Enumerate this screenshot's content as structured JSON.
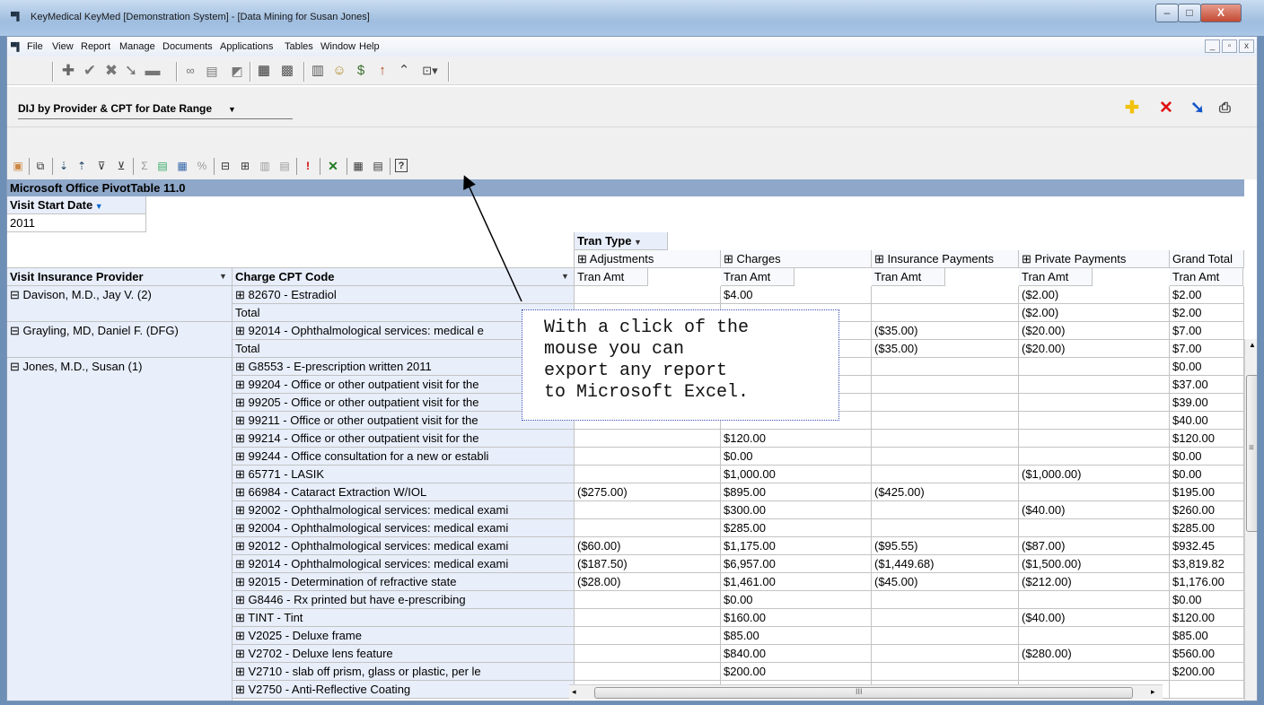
{
  "window": {
    "title": "KeyMedical KeyMed [Demonstration System] - [Data Mining for Susan Jones]",
    "app_icon": "app-icon",
    "caption_buttons": [
      "–",
      "□",
      "X"
    ]
  },
  "menu": {
    "items": [
      "File",
      "View",
      "Report",
      "Manage",
      "Documents",
      "Applications",
      "Tables",
      "Window",
      "Help"
    ],
    "mdi_buttons": [
      "_",
      "̅",
      "x"
    ]
  },
  "report": {
    "selected": "DIJ by Provider & CPT for Date Range",
    "dropdown_arrow": "▼"
  },
  "pivot": {
    "title": "Microsoft Office PivotTable 11.0",
    "filter_field": "Visit Start Date",
    "filter_value": "2011",
    "column_field": "Tran Type",
    "columns": [
      "⊞ Adjustments",
      "⊞ Charges",
      "⊞ Insurance Payments",
      "⊞ Private Payments",
      "Grand Total"
    ],
    "data_field": "Tran Amt",
    "row_field1": "Visit Insurance Provider",
    "row_field2": "Charge CPT Code",
    "providers": [
      "⊟ Davison, M.D., Jay V. (2)",
      "⊟ Grayling, MD, Daniel F. (DFG)",
      "⊟ Jones, M.D., Susan  (1)"
    ],
    "rows": [
      {
        "code": "⊞ 82670 - Estradiol",
        "adj": "",
        "chg": "$4.00",
        "ins": "",
        "prv": "($2.00)",
        "tot": "$2.00"
      },
      {
        "code": "Total",
        "adj": "",
        "chg": "",
        "ins": "",
        "prv": "($2.00)",
        "tot": "$2.00"
      },
      {
        "code": "⊞ 92014 - Ophthalmological services: medical e",
        "adj": "",
        "chg": "",
        "ins": "($35.00)",
        "prv": "($20.00)",
        "tot": "$7.00"
      },
      {
        "code": "Total",
        "adj": "",
        "chg": "",
        "ins": "($35.00)",
        "prv": "($20.00)",
        "tot": "$7.00"
      },
      {
        "code": "⊞ G8553 - E-prescription written 2011",
        "adj": "",
        "chg": "",
        "ins": "",
        "prv": "",
        "tot": "$0.00"
      },
      {
        "code": "⊞ 99204 - Office or other outpatient visit for the",
        "adj": "",
        "chg": "",
        "ins": "",
        "prv": "",
        "tot": "$37.00"
      },
      {
        "code": "⊞ 99205 - Office or other outpatient visit for the",
        "adj": "",
        "chg": "",
        "ins": "",
        "prv": "",
        "tot": "$39.00"
      },
      {
        "code": "⊞ 99211 - Office or other outpatient visit for the",
        "adj": "",
        "chg": "",
        "ins": "",
        "prv": "",
        "tot": "$40.00"
      },
      {
        "code": "⊞ 99214 - Office or other outpatient visit for the",
        "adj": "",
        "chg": "$120.00",
        "ins": "",
        "prv": "",
        "tot": "$120.00"
      },
      {
        "code": "⊞ 99244 - Office consultation for a new or establi",
        "adj": "",
        "chg": "$0.00",
        "ins": "",
        "prv": "",
        "tot": "$0.00"
      },
      {
        "code": "⊞ 65771 - LASIK",
        "adj": "",
        "chg": "$1,000.00",
        "ins": "",
        "prv": "($1,000.00)",
        "tot": "$0.00"
      },
      {
        "code": "⊞ 66984 - Cataract Extraction W/IOL",
        "adj": "($275.00)",
        "chg": "$895.00",
        "ins": "($425.00)",
        "prv": "",
        "tot": "$195.00"
      },
      {
        "code": "⊞ 92002 - Ophthalmological services: medical exami",
        "adj": "",
        "chg": "$300.00",
        "ins": "",
        "prv": "($40.00)",
        "tot": "$260.00"
      },
      {
        "code": "⊞ 92004 - Ophthalmological services: medical exami",
        "adj": "",
        "chg": "$285.00",
        "ins": "",
        "prv": "",
        "tot": "$285.00"
      },
      {
        "code": "⊞ 92012 - Ophthalmological services: medical exami",
        "adj": "($60.00)",
        "chg": "$1,175.00",
        "ins": "($95.55)",
        "prv": "($87.00)",
        "tot": "$932.45"
      },
      {
        "code": "⊞ 92014 - Ophthalmological services: medical exami",
        "adj": "($187.50)",
        "chg": "$6,957.00",
        "ins": "($1,449.68)",
        "prv": "($1,500.00)",
        "tot": "$3,819.82"
      },
      {
        "code": "⊞ 92015 - Determination of refractive state",
        "adj": "($28.00)",
        "chg": "$1,461.00",
        "ins": "($45.00)",
        "prv": "($212.00)",
        "tot": "$1,176.00"
      },
      {
        "code": "⊞ G8446 - Rx printed but have e-prescribing",
        "adj": "",
        "chg": "$0.00",
        "ins": "",
        "prv": "",
        "tot": "$0.00"
      },
      {
        "code": "⊞ TINT - Tint",
        "adj": "",
        "chg": "$160.00",
        "ins": "",
        "prv": "($40.00)",
        "tot": "$120.00"
      },
      {
        "code": "⊞ V2025 - Deluxe frame",
        "adj": "",
        "chg": "$85.00",
        "ins": "",
        "prv": "",
        "tot": "$85.00"
      },
      {
        "code": "⊞ V2702 - Deluxe lens feature",
        "adj": "",
        "chg": "$840.00",
        "ins": "",
        "prv": "($280.00)",
        "tot": "$560.00"
      },
      {
        "code": "⊞ V2710 - slab off prism, glass or plastic, per le",
        "adj": "",
        "chg": "$200.00",
        "ins": "",
        "prv": "",
        "tot": "$200.00"
      },
      {
        "code": "⊞ V2750 - Anti-Reflective Coating",
        "adj": "",
        "chg": "",
        "ins": "",
        "prv": "",
        "tot": ""
      }
    ]
  },
  "callout": {
    "text": "With a click of the\nmouse you can\nexport any report\nto Microsoft Excel."
  },
  "scroll": {
    "h_thumb_glyph": "III",
    "v_thumb_glyph": "≡"
  },
  "icons": {
    "toolbar1": [
      "add-icon",
      "check-icon",
      "cancel-icon",
      "redo-icon",
      "print-icon",
      "binoculars-icon",
      "notepad-icon",
      "edit-icon",
      "database-icon",
      "calculator-icon",
      "table-icon",
      "people-icon",
      "money-icon",
      "chart-icon",
      "tools-icon",
      "dropdown-icon"
    ],
    "report_actions": [
      "add-icon",
      "delete-icon",
      "download-icon",
      "print-icon"
    ],
    "pivot_toolbar": [
      "format-icon",
      "copy-icon",
      "sort-asc-icon",
      "sort-desc-icon",
      "filter-icon",
      "show-top-icon",
      "autosum-icon",
      "subtotal-icon",
      "calculated-icon",
      "percent-icon",
      "collapse-icon",
      "expand-icon",
      "hide-details-icon",
      "show-details-icon",
      "refresh-icon",
      "export-excel-icon",
      "field-list-icon",
      "property-icon",
      "help-icon"
    ]
  },
  "colors": {
    "title_bar": "#8fa8c9",
    "header_fill": "#e8eefa",
    "excel_green": "#1f7a1f",
    "callout_border": "#3b4fb5"
  }
}
